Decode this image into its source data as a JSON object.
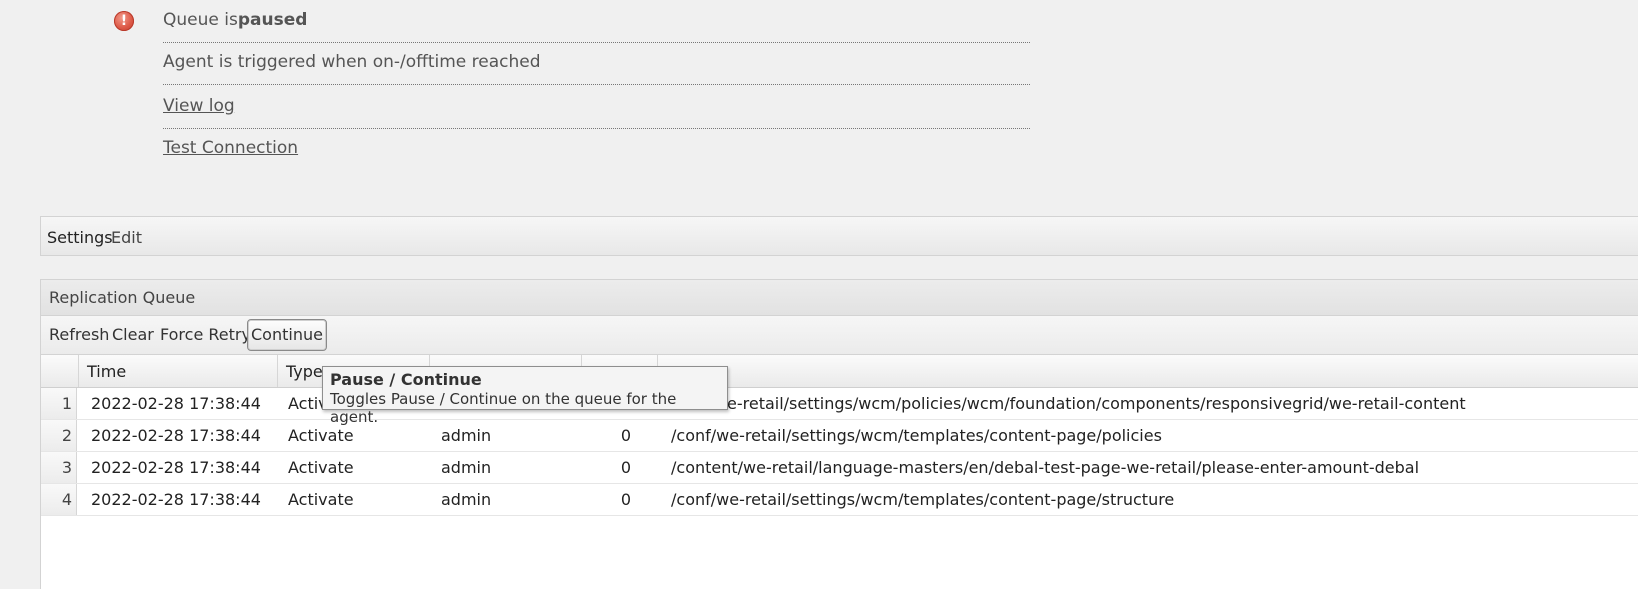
{
  "status": {
    "queue_prefix": "Queue is ",
    "queue_state": "paused",
    "trigger_text": "Agent is triggered when on-/offtime reached",
    "view_log": "View log",
    "test_connection": "Test Connection"
  },
  "settings_bar": {
    "settings_label": "Settings",
    "edit_label": "Edit"
  },
  "queue": {
    "title": "Replication Queue",
    "toolbar": {
      "refresh": "Refresh",
      "clear": "Clear",
      "force_retry": "Force Retry",
      "continue": "Continue"
    },
    "columns": {
      "time": "Time",
      "type": "Type",
      "user": "",
      "retries": "",
      "path": ""
    },
    "rows": [
      {
        "num": "1",
        "time": "2022-02-28 17:38:44",
        "type": "Activ",
        "user": "",
        "retries": "",
        "path": "e-retail/settings/wcm/policies/wcm/foundation/components/responsivegrid/we-retail-content"
      },
      {
        "num": "2",
        "time": "2022-02-28 17:38:44",
        "type": "Activate",
        "user": "admin",
        "retries": "0",
        "path": "/conf/we-retail/settings/wcm/templates/content-page/policies"
      },
      {
        "num": "3",
        "time": "2022-02-28 17:38:44",
        "type": "Activate",
        "user": "admin",
        "retries": "0",
        "path": "/content/we-retail/language-masters/en/debal-test-page-we-retail/please-enter-amount-debal"
      },
      {
        "num": "4",
        "time": "2022-02-28 17:38:44",
        "type": "Activate",
        "user": "admin",
        "retries": "0",
        "path": "/conf/we-retail/settings/wcm/templates/content-page/structure"
      }
    ]
  },
  "tooltip": {
    "title": "Pause / Continue",
    "text": "Toggles Pause / Continue on the queue for the agent."
  },
  "icons": {
    "alert": "alert-circle-icon"
  },
  "colors": {
    "alert_red": "#dd5a48"
  }
}
